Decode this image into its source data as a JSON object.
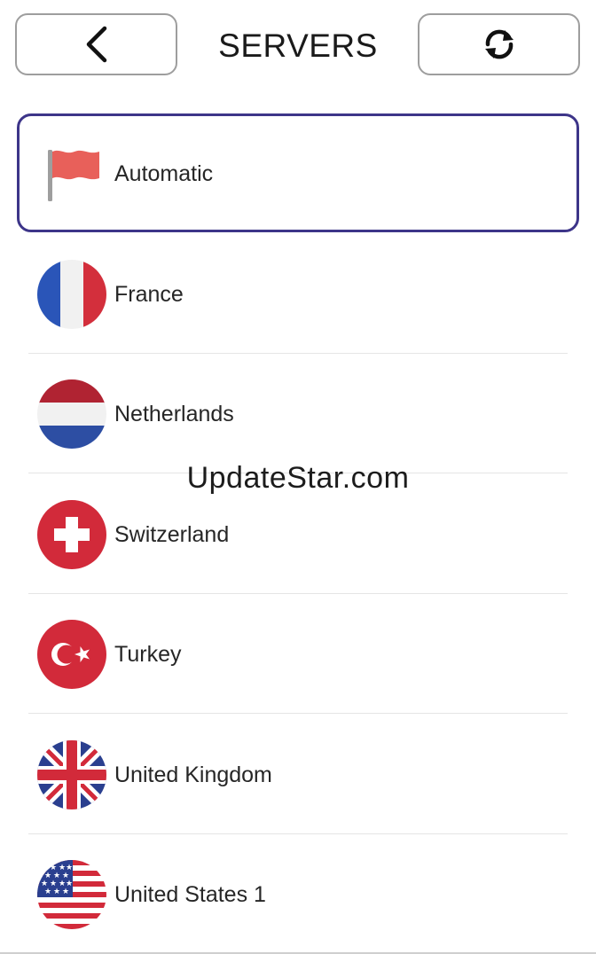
{
  "header": {
    "title": "SERVERS",
    "back_icon": "chevron-left-icon",
    "refresh_icon": "refresh-icon"
  },
  "automatic": {
    "label": "Automatic",
    "icon": "flag-icon",
    "flag_color": "#e8605a",
    "selected_border_color": "#3d3589"
  },
  "servers": [
    {
      "label": "France",
      "icon": "france-flag-icon"
    },
    {
      "label": "Netherlands",
      "icon": "netherlands-flag-icon"
    },
    {
      "label": "Switzerland",
      "icon": "switzerland-flag-icon"
    },
    {
      "label": "Turkey",
      "icon": "turkey-flag-icon"
    },
    {
      "label": "United Kingdom",
      "icon": "united-kingdom-flag-icon"
    },
    {
      "label": "United States 1",
      "icon": "united-states-flag-icon"
    }
  ],
  "watermark": "UpdateStar.com"
}
